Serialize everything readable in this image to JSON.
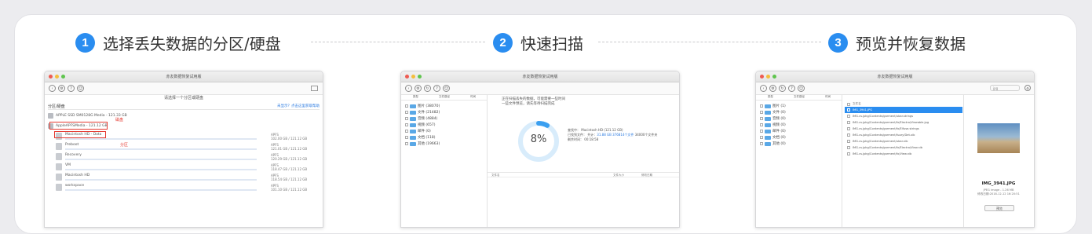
{
  "steps": [
    {
      "num": "1",
      "title": "选择丢失数据的分区/硬盘"
    },
    {
      "num": "2",
      "title": "快速扫描"
    },
    {
      "num": "3",
      "title": "预览并恢复数据"
    }
  ],
  "accent": "#2a8df0",
  "window1": {
    "title": "赤友数据恢复试用版",
    "prompt": "请选择一个分区或硬盘",
    "section": "分区/硬盘",
    "link": "未显示？点击这里获取帮助",
    "disks": [
      {
        "name": "APPLE SSD SM0128G Media - 121.33 GB"
      },
      {
        "name": "AppleAPFSMedia - 121.12 GB"
      }
    ],
    "volumes": [
      {
        "name": "Macintosh HD - Data",
        "meta": "APFS\n102.00 GB / 121.12 GB"
      },
      {
        "name": "Preboot",
        "meta": "APFS\n121.01 GB / 121.12 GB"
      },
      {
        "name": "Recovery",
        "meta": "APFS\n120.29 GB / 121.12 GB"
      },
      {
        "name": "VM",
        "meta": "APFS\n118.47 GB / 121.12 GB"
      },
      {
        "name": "Macintosh HD",
        "meta": "APFS\n118.54 GB / 121.12 GB"
      },
      {
        "name": "workspace",
        "meta": "APFS\n101.10 GB / 121.12 GB"
      }
    ],
    "annot1": "磁盘",
    "annot2": "分区"
  },
  "window2": {
    "title": "赤友数据恢复试用版",
    "tabs": [
      "类型",
      "文件路径",
      "时间"
    ],
    "folders": [
      {
        "label": "图片 (38070)"
      },
      {
        "label": "文件 (21482)"
      },
      {
        "label": "音频 (4884)"
      },
      {
        "label": "视频 (657)"
      },
      {
        "label": "邮件 (0)"
      },
      {
        "label": "文档 (118)"
      },
      {
        "label": "其他 (19663)"
      }
    ],
    "note_line1": "正在扫描丢失的数据，可能需要一些时间",
    "note_line2": "一些文件预览，请先等待扫描完成",
    "progress": 8,
    "progress_label": "8%",
    "info": {
      "device_label": "查找中：",
      "device": "Macintosh HD (121.12 GB)",
      "found_label": "已找到文件：",
      "found_prefix": "共计：",
      "found_size": "31.88 GB",
      "found_files": "376814个文件",
      "found_dirs": "34000个文件夹",
      "time_label": "剩余时间：",
      "time": "00:18:58"
    },
    "table_cols": [
      "文件名",
      "文件大小",
      "修改日期"
    ]
  },
  "window3": {
    "title": "赤友数据恢复试用版",
    "search": "jpg",
    "tabs": [
      "类型",
      "文件路径",
      "时间"
    ],
    "folders": [
      {
        "label": "图片 (1)"
      },
      {
        "label": "文件 (0)"
      },
      {
        "label": "音频 (0)"
      },
      {
        "label": "视频 (0)"
      },
      {
        "label": "邮件 (0)"
      },
      {
        "label": "文档 (0)"
      },
      {
        "label": "其他 (0)"
      }
    ],
    "list_header": "文件名",
    "files": [
      {
        "name": "IMG_3941.JPG",
        "selected": true
      },
      {
        "name": "IMG.cs.jpkg/Contents/garment/ubar.strings",
        "selected": false
      },
      {
        "name": "IMG.cs.jpkg/Contents/garment/fx/Electra/Viewable.jpg",
        "selected": false
      },
      {
        "name": "IMG.cs.jpkg/Contents/garment/fx/Elfuse.strings",
        "selected": false
      },
      {
        "name": "IMG.cs.jpkg/Contents/garment/fuzzy/Det.xib",
        "selected": false
      },
      {
        "name": "IMG.cs.jpkg/Contents/garment/ubar.nib",
        "selected": false
      },
      {
        "name": "IMG.cs.jpkg/Contents/garment/fx/Electra/View.nib",
        "selected": false
      },
      {
        "name": "IMG.cs.jpkg/Contents/garment/fx/View.nib",
        "selected": false
      }
    ],
    "preview_name": "IMG_3941.JPG",
    "preview_meta1": "JPEG image - 1.26 MB",
    "preview_meta2": "修改日期:2018-12-12 16:20:51",
    "preview_button": "预览"
  }
}
